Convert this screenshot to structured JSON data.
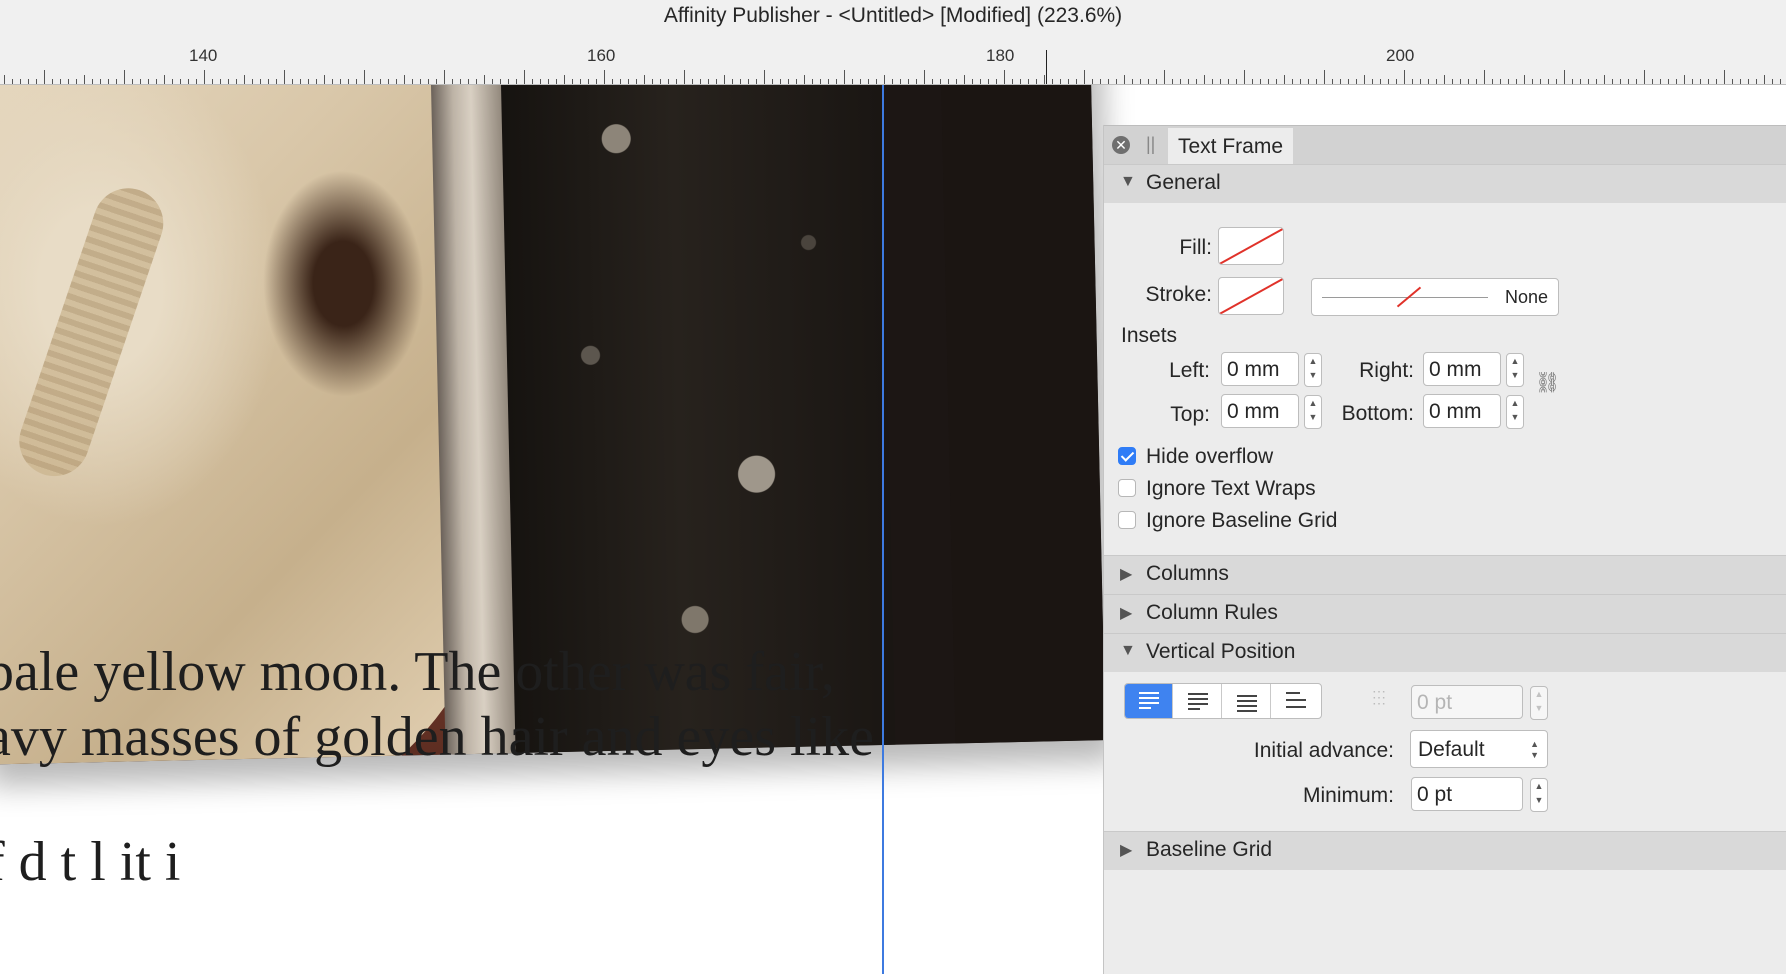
{
  "window": {
    "title": "Affinity Publisher - <Untitled> [Modified] (223.6%)"
  },
  "ruler": {
    "labels": [
      "140",
      "160",
      "180",
      "200"
    ]
  },
  "document": {
    "lines": [
      "pale yellow moon. The other was fair,",
      "avy masses of golden hair and eyes like",
      "    f             d t   l       it i"
    ]
  },
  "panel": {
    "tab": "Text Frame",
    "general": {
      "header": "General",
      "fill_label": "Fill:",
      "stroke_label": "Stroke:",
      "stroke_style": "None",
      "insets_label": "Insets",
      "left_label": "Left:",
      "left_value": "0 mm",
      "right_label": "Right:",
      "right_value": "0 mm",
      "top_label": "Top:",
      "top_value": "0 mm",
      "bottom_label": "Bottom:",
      "bottom_value": "0 mm",
      "hide_overflow": "Hide overflow",
      "hide_overflow_checked": true,
      "ignore_text_wraps": "Ignore Text Wraps",
      "ignore_text_wraps_checked": false,
      "ignore_baseline_grid": "Ignore Baseline Grid",
      "ignore_baseline_grid_checked": false
    },
    "columns_header": "Columns",
    "column_rules_header": "Column Rules",
    "vertical_position": {
      "header": "Vertical Position",
      "spacing_value": "0 pt",
      "initial_advance_label": "Initial advance:",
      "initial_advance_value": "Default",
      "minimum_label": "Minimum:",
      "minimum_value": "0 pt"
    },
    "baseline_grid_header": "Baseline Grid"
  },
  "colors": {
    "accent": "#2f7cf6",
    "guide": "#3d7ae0",
    "no_fill": "#e0322a"
  }
}
